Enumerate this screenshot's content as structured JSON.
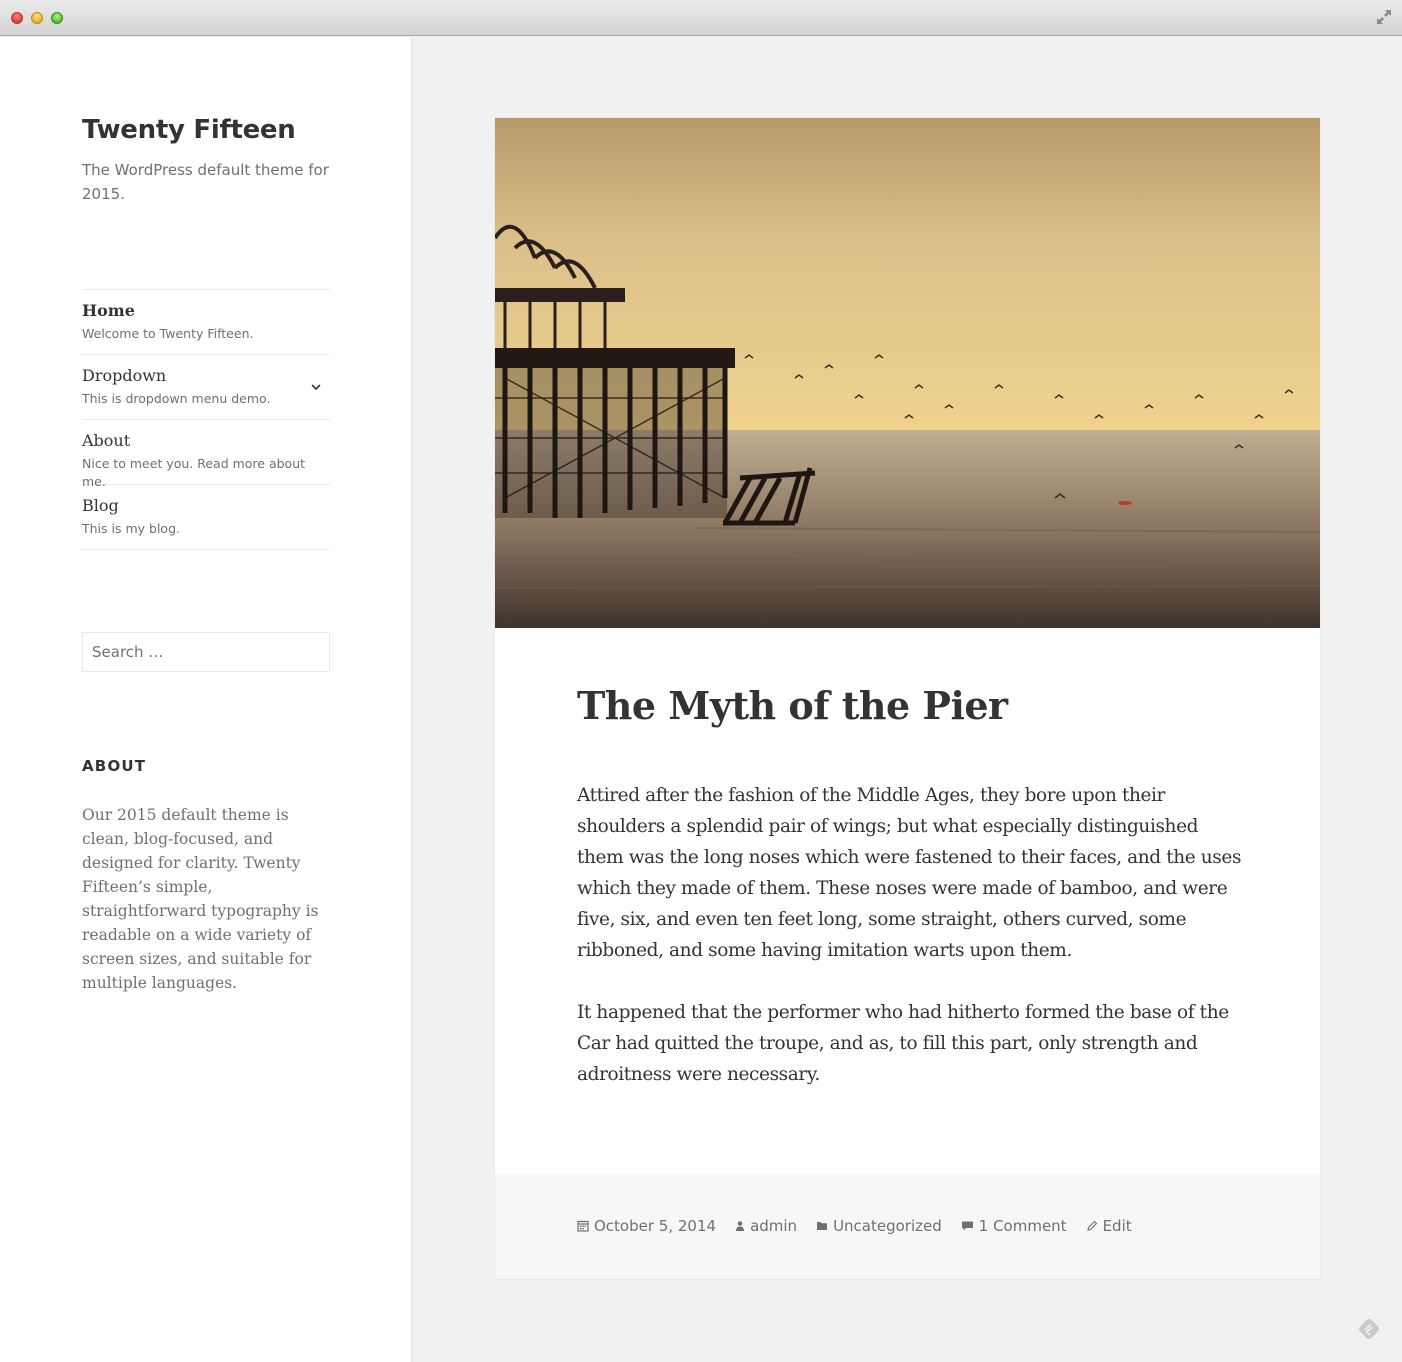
{
  "window": {
    "controls": [
      "close",
      "minimize",
      "maximize"
    ],
    "fullscreen_icon": "fullscreen-arrows-icon"
  },
  "site": {
    "title": "Twenty Fifteen",
    "description": "The WordPress default theme for 2015."
  },
  "nav": {
    "items": [
      {
        "label": "Home",
        "description": "Welcome to Twenty Fifteen.",
        "current": true
      },
      {
        "label": "Dropdown",
        "description": "This is dropdown menu demo.",
        "has_children": true
      },
      {
        "label": "About",
        "description": "Nice to meet you. Read more about me."
      },
      {
        "label": "Blog",
        "description": "This is my blog."
      }
    ]
  },
  "search": {
    "placeholder": "Search …",
    "value": ""
  },
  "widget": {
    "title": "ABOUT",
    "text": "Our 2015 default theme is clean, blog-focused, and designed for clarity. Twenty Fifteen’s simple, straightforward typography is readable on a wide variety of screen sizes, and suitable for multiple languages."
  },
  "post": {
    "image_alt": "Sunset over a ruined pier with seagulls flying over the sea",
    "title": "The Myth of the Pier",
    "paragraphs": [
      "Attired after the fashion of the Middle Ages, they bore upon their shoulders a splendid pair of wings; but what especially distinguished them was the long noses which were fastened to their faces, and the uses which they made of them. These noses were made of bamboo, and were five, six, and even ten feet long, some straight, others curved, some ribboned, and some having imitation warts upon them.",
      "It happened that the performer who had hitherto formed the base of the Car had quitted the troupe, and as, to fill this part, only strength and adroitness were necessary."
    ],
    "meta": {
      "date": "October 5, 2014",
      "author": "admin",
      "category": "Uncategorized",
      "comments": "1 Comment",
      "edit": "Edit"
    }
  },
  "colors": {
    "background": "#f1f1f1",
    "text": "#333333",
    "muted": "#707070",
    "border": "#eaeaea",
    "footer_bg": "#f7f7f7"
  }
}
